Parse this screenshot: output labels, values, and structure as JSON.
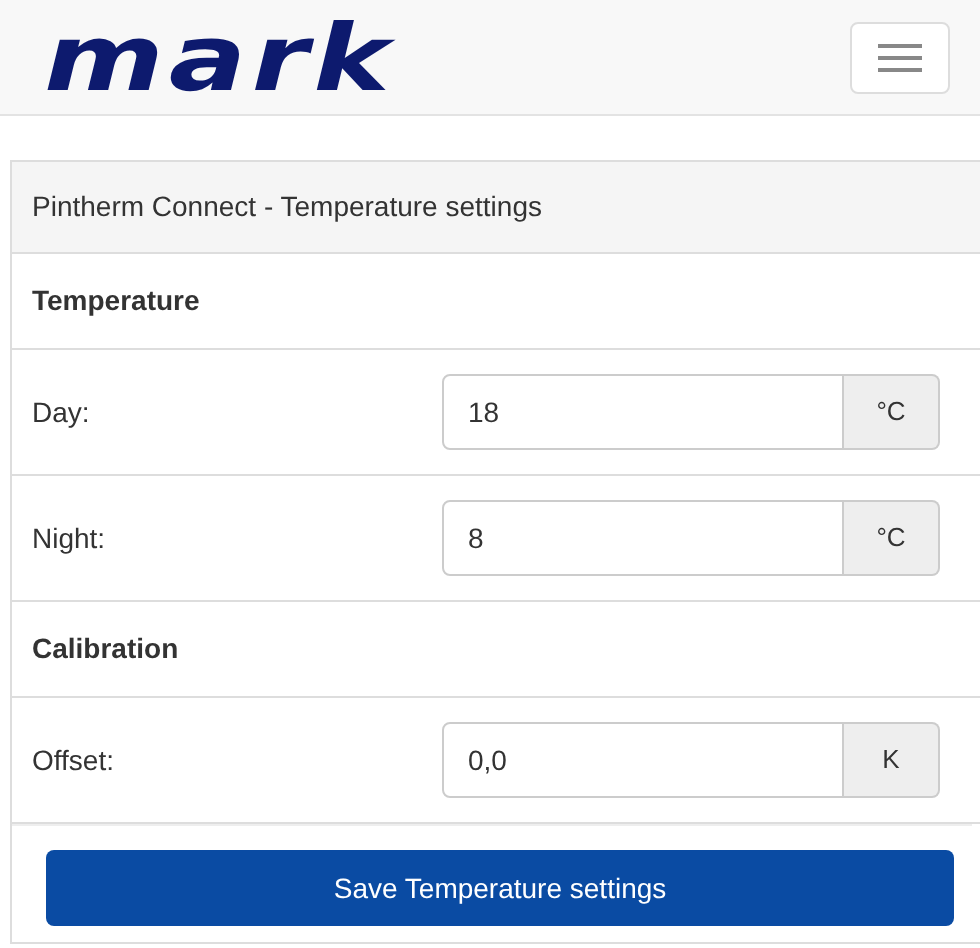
{
  "logo": "mark",
  "panel": {
    "title": "Pintherm Connect - Temperature settings",
    "sections": [
      {
        "heading": "Temperature",
        "rows": [
          {
            "label": "Day:",
            "value": "18",
            "unit": "°C"
          },
          {
            "label": "Night:",
            "value": "8",
            "unit": "°C"
          }
        ]
      },
      {
        "heading": "Calibration",
        "rows": [
          {
            "label": "Offset:",
            "value": "0,0",
            "unit": "K"
          }
        ]
      }
    ]
  },
  "save_button": "Save Temperature settings"
}
